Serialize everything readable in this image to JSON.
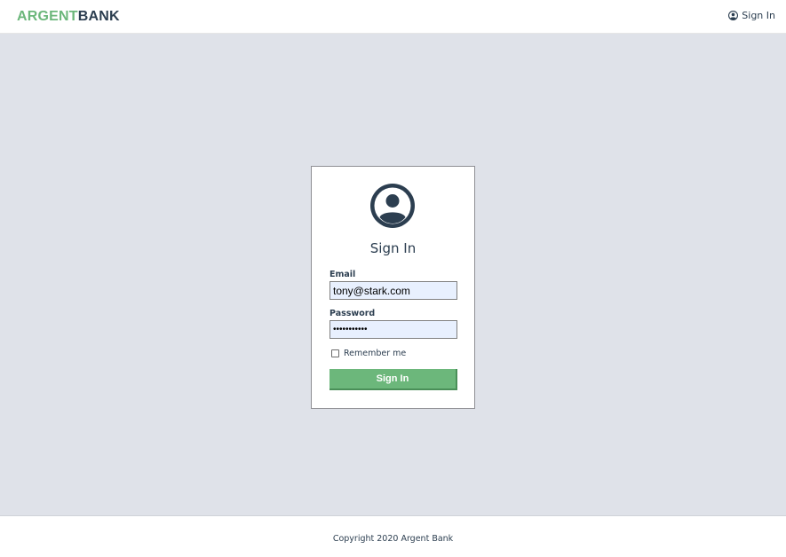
{
  "header": {
    "logo_part1": "ARGENT",
    "logo_part2": "BANK",
    "signin_label": "Sign In",
    "signin_icon": "user-circle-icon"
  },
  "login_card": {
    "avatar_icon": "user-circle-icon",
    "title": "Sign In",
    "email_label": "Email",
    "email_value": "tony@stark.com",
    "password_label": "Password",
    "password_value": "password123",
    "remember_label": "Remember me",
    "remember_checked": false,
    "submit_label": "Sign In"
  },
  "footer": {
    "copyright": "Copyright 2020 Argent Bank"
  },
  "colors": {
    "brand_green": "#6cb77b",
    "brand_dark": "#2c3e50",
    "page_background": "#dfe2e9",
    "input_autofill": "#e8f0fe"
  }
}
